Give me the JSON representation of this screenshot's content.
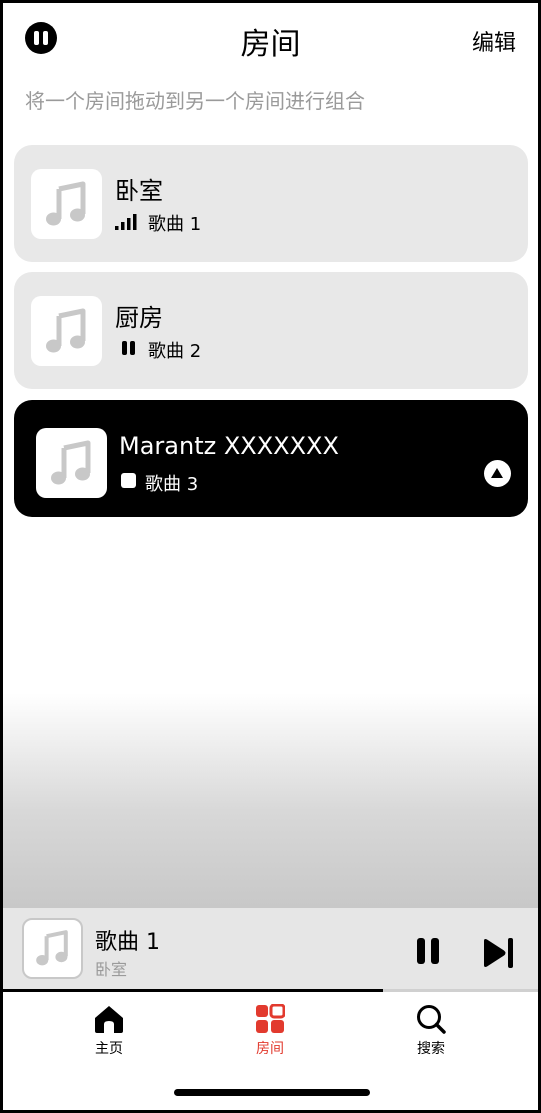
{
  "header": {
    "title": "房间",
    "edit_label": "编辑",
    "hint": "将一个房间拖动到另一个房间进行组合"
  },
  "rooms": [
    {
      "name": "卧室",
      "track": "歌曲 1",
      "status_icon": "signal-bars-icon",
      "active": false
    },
    {
      "name": "厨房",
      "track": "歌曲 2",
      "status_icon": "pause-icon",
      "active": false
    },
    {
      "name": "Marantz XXXXXXX",
      "track": "歌曲 3",
      "status_icon": "stop-icon",
      "active": true
    }
  ],
  "now_playing": {
    "track": "歌曲 1",
    "room": "卧室",
    "progress": 0.71
  },
  "tabs": [
    {
      "label": "主页",
      "icon": "home-icon",
      "active": false
    },
    {
      "label": "房间",
      "icon": "rooms-grid-icon",
      "active": true
    },
    {
      "label": "搜索",
      "icon": "search-icon",
      "active": false
    }
  ],
  "colors": {
    "accent": "#e23a2e",
    "card": "#e8e8e8",
    "active_card": "#000000",
    "muted_text": "#9a9a9a"
  }
}
